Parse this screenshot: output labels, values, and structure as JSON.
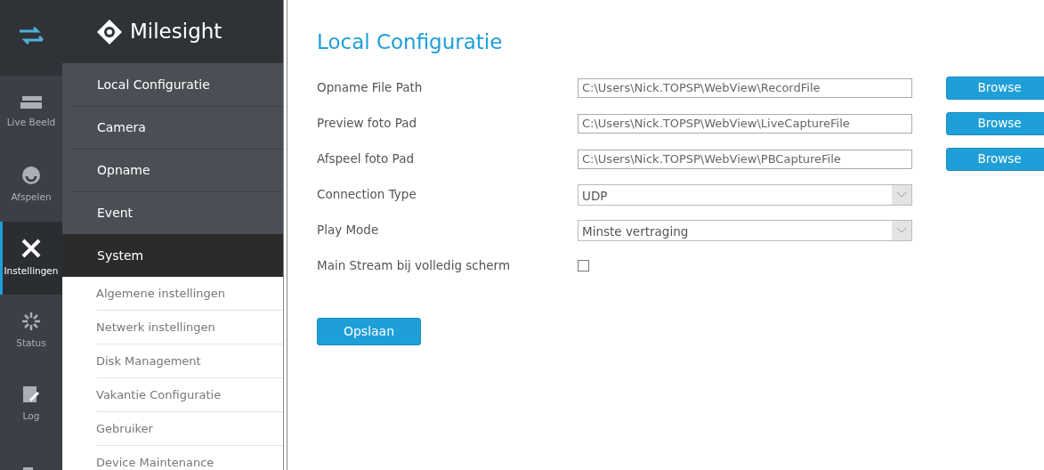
{
  "rail": [
    {
      "kind": "toggle",
      "selected": false
    },
    {
      "kind": "live",
      "label": "Live Beeld",
      "selected": false
    },
    {
      "kind": "playback",
      "label": "Afspelen",
      "selected": false
    },
    {
      "kind": "settings",
      "label": "Instellingen",
      "selected": true
    },
    {
      "kind": "status",
      "label": "Status",
      "selected": false
    },
    {
      "kind": "log",
      "label": "Log",
      "selected": false
    },
    {
      "kind": "logout",
      "selected": false
    }
  ],
  "brand": "Milesight",
  "menu": [
    {
      "label": "Local Configuratie",
      "expanded": false
    },
    {
      "label": "Camera",
      "expanded": false
    },
    {
      "label": "Opname",
      "expanded": false
    },
    {
      "label": "Event",
      "expanded": false
    },
    {
      "label": "System",
      "expanded": true,
      "children": [
        {
          "label": "Algemene instellingen"
        },
        {
          "label": "Netwerk instellingen"
        },
        {
          "label": "Disk Management"
        },
        {
          "label": "Vakantie Configuratie"
        },
        {
          "label": "Gebruiker"
        },
        {
          "label": "Device Maintenance"
        }
      ]
    }
  ],
  "title": "Local Configuratie",
  "fields": [
    {
      "kind": "path",
      "label": "Opname File Path",
      "value": "C:\\Users\\Nick.TOPSP\\WebView\\RecordFile",
      "button": "Browse"
    },
    {
      "kind": "path",
      "label": "Preview foto Pad",
      "value": "C:\\Users\\Nick.TOPSP\\WebView\\LiveCaptureFile",
      "button": "Browse"
    },
    {
      "kind": "path",
      "label": "Afspeel foto Pad",
      "value": "C:\\Users\\Nick.TOPSP\\WebView\\PBCaptureFile",
      "button": "Browse"
    },
    {
      "kind": "select",
      "label": "Connection Type",
      "value": "UDP"
    },
    {
      "kind": "select",
      "label": "Play Mode",
      "value": "Minste vertraging"
    },
    {
      "kind": "checkbox",
      "label": "Main Stream bij volledig scherm",
      "checked": false
    }
  ],
  "save_button": "Opslaan"
}
